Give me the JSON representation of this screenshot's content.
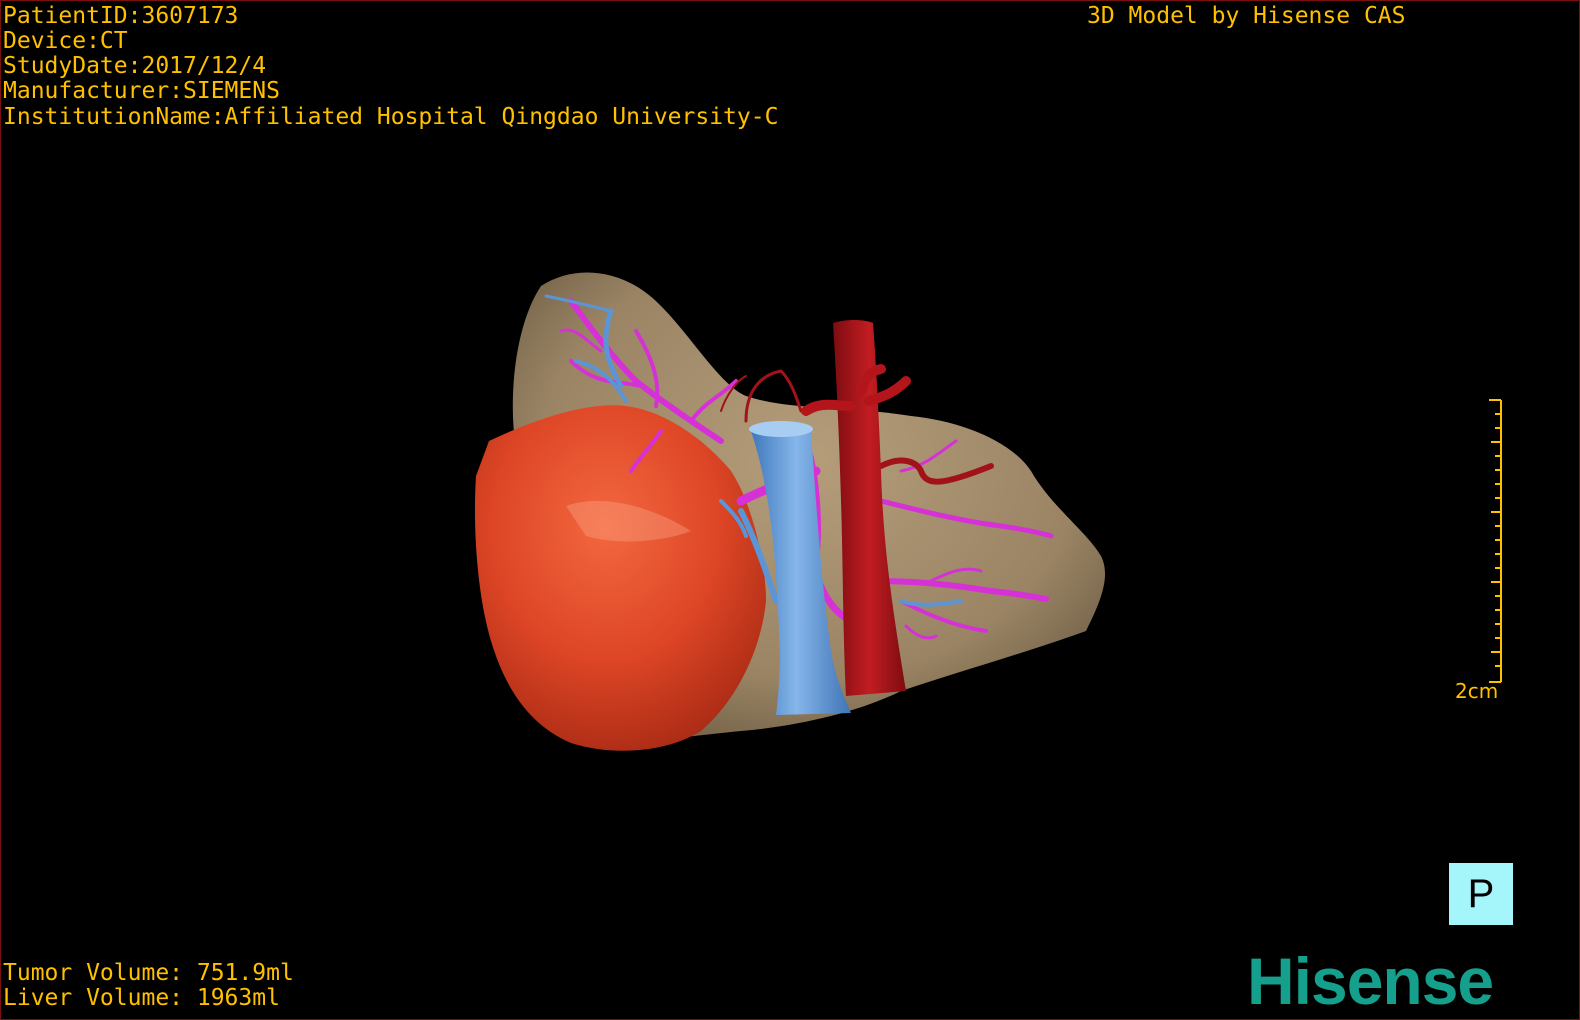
{
  "header": {
    "patient_id": "PatientID:3607173",
    "device": "Device:CT",
    "study_date": "StudyDate:2017/12/4",
    "manufacturer": "Manufacturer:SIEMENS",
    "institution": "InstitutionName:Affiliated Hospital Qingdao University-C",
    "model_credit": "3D Model by Hisense CAS"
  },
  "scale": {
    "label": "2cm"
  },
  "orientation": {
    "label": "P"
  },
  "volumes": {
    "tumor": "Tumor Volume: 751.9ml",
    "liver": "Liver Volume: 1963ml"
  },
  "brand": {
    "logo_text": "Hisense"
  },
  "colors": {
    "overlay_text": "#ffc000",
    "liver": "#a08a6a",
    "tumor": "#e0472a",
    "portal_vein": "#5b95d6",
    "artery": "#b3151a",
    "hepatic_vein": "#d631d6",
    "orientation_box": "#a5f6fb",
    "logo": "#14a08c"
  }
}
